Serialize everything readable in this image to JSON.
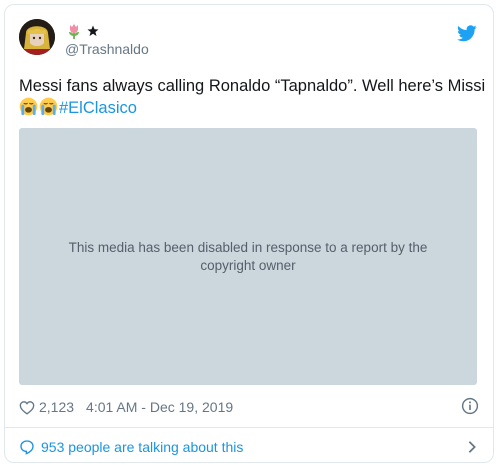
{
  "user": {
    "handle": "@Trashnaldo",
    "display_name_icons": [
      "tulip-emoji",
      "star-icon"
    ]
  },
  "tweet": {
    "text": "Messi fans always calling Ronaldo “Tapnaldo”. Well here’s Missi",
    "emojis": [
      "loudly-crying-face-emoji",
      "loudly-crying-face-emoji"
    ],
    "hashtag": "#ElClasico"
  },
  "media": {
    "notice": "This media has been disabled in response to a report by the copyright owner"
  },
  "meta": {
    "likes": "2,123",
    "timestamp": "4:01 AM - Dec 19, 2019"
  },
  "footer": {
    "conversation": "953 people are talking about this"
  },
  "colors": {
    "twitter_blue": "#1da1f2",
    "link_blue": "#1b95e0",
    "media_bg": "#ccd6dd",
    "muted_text": "#657786"
  }
}
